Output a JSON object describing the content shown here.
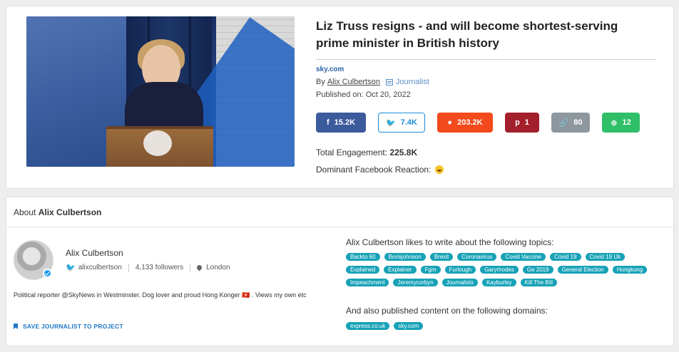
{
  "article": {
    "headline": "Liz Truss resigns - and will become shortest-serving prime minister in British history",
    "source": "sky.com",
    "by_label": "By",
    "author": "Alix Culbertson",
    "author_role": "Journalist",
    "published": "Published on: Oct 20, 2022",
    "shares": {
      "facebook": "15.2K",
      "twitter": "7.4K",
      "reddit": "203.2K",
      "pinterest": "1",
      "links": "80",
      "other": "12"
    },
    "total_engagement_label": "Total Engagement:",
    "total_engagement_value": "225.8K",
    "dominant_reaction_label": "Dominant Facebook Reaction:",
    "dominant_reaction_icon": "laughing-emoji-icon"
  },
  "about": {
    "title_prefix": "About",
    "name": "Alix Culbertson",
    "twitter_handle": "alixculbertson",
    "followers": "4,133 followers",
    "location": "London",
    "bio": "Political reporter @SkyNews in Westminster. Dog lover and proud Hong Konger 🇭🇰 . Views my own etc",
    "save_label": "SAVE JOURNALIST TO PROJECT",
    "topics_label": "Alix Culbertson likes to write about the following topics:",
    "topics": [
      "Backto 60",
      "Borisjohnson",
      "Brexit",
      "Coronavirus",
      "Covid Vaccine",
      "Covid 19",
      "Covid 19 Uk",
      "Explained",
      "Explainer",
      "Fgm",
      "Furlough",
      "Garyrhodes",
      "Ge 2019",
      "General Election",
      "Hongkong",
      "Impeachment",
      "Jeremycorbyn",
      "Journalists",
      "Kayburley",
      "Kill The Bill"
    ],
    "domains_label": "And also published content on the following domains:",
    "domains": [
      "express.co.uk",
      "sky.com"
    ]
  },
  "colors": {
    "facebook": "#3b5b9d",
    "twitter": "#1d8ddb",
    "reddit": "#f24a1d",
    "pinterest": "#a31f2c",
    "links": "#8f979e",
    "other": "#2fbf68",
    "tag": "#17a2b8",
    "link_blue": "#1e78c8"
  }
}
